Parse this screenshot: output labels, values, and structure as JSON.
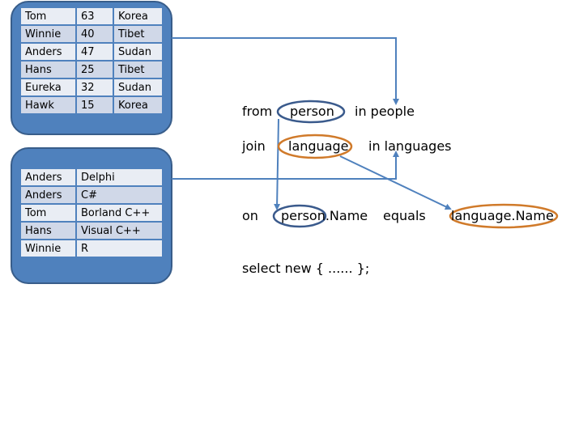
{
  "people": {
    "rows": [
      [
        "Tom",
        "63",
        "Korea"
      ],
      [
        "Winnie",
        "40",
        "Tibet"
      ],
      [
        "Anders",
        "47",
        "Sudan"
      ],
      [
        "Hans",
        "25",
        "Tibet"
      ],
      [
        "Eureka",
        "32",
        "Sudan"
      ],
      [
        "Hawk",
        "15",
        "Korea"
      ]
    ]
  },
  "languages": {
    "rows": [
      [
        "Anders",
        "Delphi"
      ],
      [
        "Anders",
        "C#"
      ],
      [
        "Tom",
        "Borland C++"
      ],
      [
        "Hans",
        "Visual C++"
      ],
      [
        "Winnie",
        "R"
      ]
    ]
  },
  "query": {
    "from_kw": "from",
    "from_var": "person",
    "from_src": "in people",
    "join_kw": "join",
    "join_var": "language",
    "join_src": "in languages",
    "on_kw": "on",
    "on_left": "person.Name",
    "equals_kw": "equals",
    "on_right": "language.Name",
    "select": "select new { ...... };"
  },
  "colors": {
    "panel": "#4f81bd",
    "arrow": "#4f81bd",
    "person_ellipse": "#3a5a8c",
    "language_ellipse": "#d07a2a"
  }
}
